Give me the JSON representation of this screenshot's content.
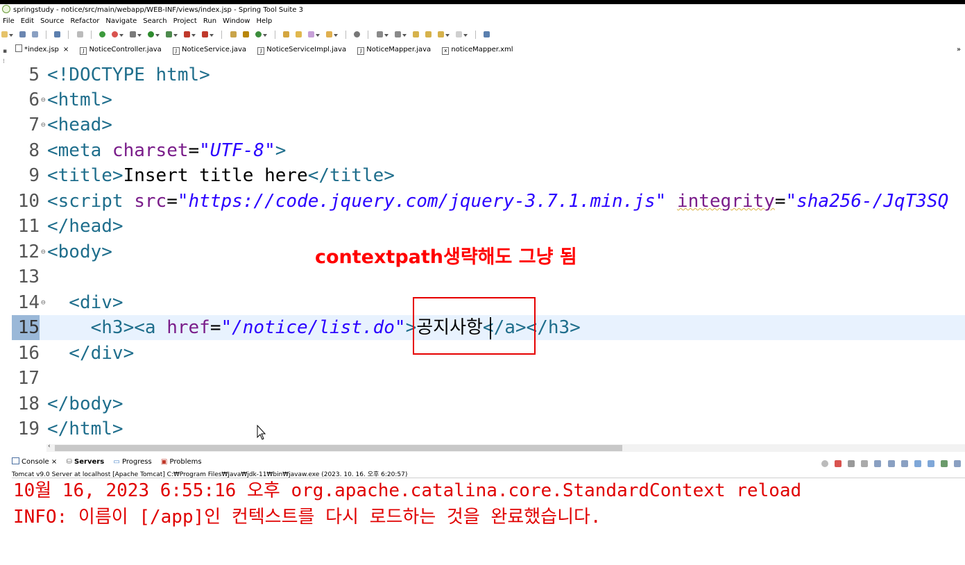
{
  "window": {
    "title": "springstudy - notice/src/main/webapp/WEB-INF/views/index.jsp - Spring Tool Suite 3"
  },
  "menu": [
    "File",
    "Edit",
    "Source",
    "Refactor",
    "Navigate",
    "Search",
    "Project",
    "Run",
    "Window",
    "Help"
  ],
  "tabs": [
    {
      "label": "*index.jsp",
      "active": true,
      "icon": "jsp-file-icon"
    },
    {
      "label": "NoticeController.java",
      "icon": "java-file-icon"
    },
    {
      "label": "NoticeService.java",
      "icon": "java-file-icon"
    },
    {
      "label": "NoticeServiceImpl.java",
      "icon": "java-file-icon"
    },
    {
      "label": "NoticeMapper.java",
      "icon": "java-file-icon"
    },
    {
      "label": "noticeMapper.xml",
      "icon": "xml-file-icon"
    }
  ],
  "tab_overflow_glyph": "»",
  "editor": {
    "current_line": "15",
    "lines": [
      {
        "n": "5",
        "p": [
          "<!DOCTYPE html>"
        ]
      },
      {
        "n": "6",
        "p": [
          "<html>"
        ]
      },
      {
        "n": "7",
        "p": [
          "<head>"
        ]
      },
      {
        "n": "8",
        "p": [
          "<meta ",
          "charset",
          "=",
          "\"UTF-8\"",
          ">"
        ]
      },
      {
        "n": "9",
        "p": [
          "<title>",
          "Insert title here",
          "</title>"
        ]
      },
      {
        "n": "10",
        "p": [
          "<script ",
          "src",
          "=",
          "\"https://code.jquery.com/jquery-3.7.1.min.js\"",
          " ",
          "integrity",
          "=",
          "\"sha256-/JqT3SQ"
        ]
      },
      {
        "n": "11",
        "p": [
          "</head>"
        ]
      },
      {
        "n": "12",
        "p": [
          "<body>"
        ]
      },
      {
        "n": "13",
        "p": [
          ""
        ]
      },
      {
        "n": "14",
        "p": [
          "  <div>"
        ]
      },
      {
        "n": "15",
        "p": [
          "    <h3><a ",
          "href",
          "=",
          "\"/notice/list.do\"",
          ">",
          "공지사항",
          "</a></h3>"
        ]
      },
      {
        "n": "16",
        "p": [
          "  </div>"
        ]
      },
      {
        "n": "17",
        "p": [
          ""
        ]
      },
      {
        "n": "18",
        "p": [
          "</body>"
        ]
      },
      {
        "n": "19",
        "p": [
          "</html>"
        ]
      }
    ]
  },
  "annotation": "contextpath생략해도 그냥 됨",
  "console": {
    "tabs": [
      "Console",
      "Servers",
      "Progress",
      "Problems"
    ],
    "description": "Tomcat v9.0 Server at localhost [Apache Tomcat] C:₩Program Files₩Java₩jdk-11₩bin₩javaw.exe  (2023. 10. 16. 오후 6:20:57)",
    "lines": [
      "10월 16, 2023 6:55:16 오후 org.apache.catalina.core.StandardContext reload",
      "INFO: 이름이 [/app]인 컨텍스트를 다시 로드하는 것을 완료했습니다."
    ]
  },
  "colors": {
    "tag": "#1f6e8c",
    "attribute": "#7a1d8a",
    "string": "#2a00ff",
    "annotation": "#ff0000",
    "console_text": "#e00000",
    "current_line_bg": "#e8f2fe"
  }
}
